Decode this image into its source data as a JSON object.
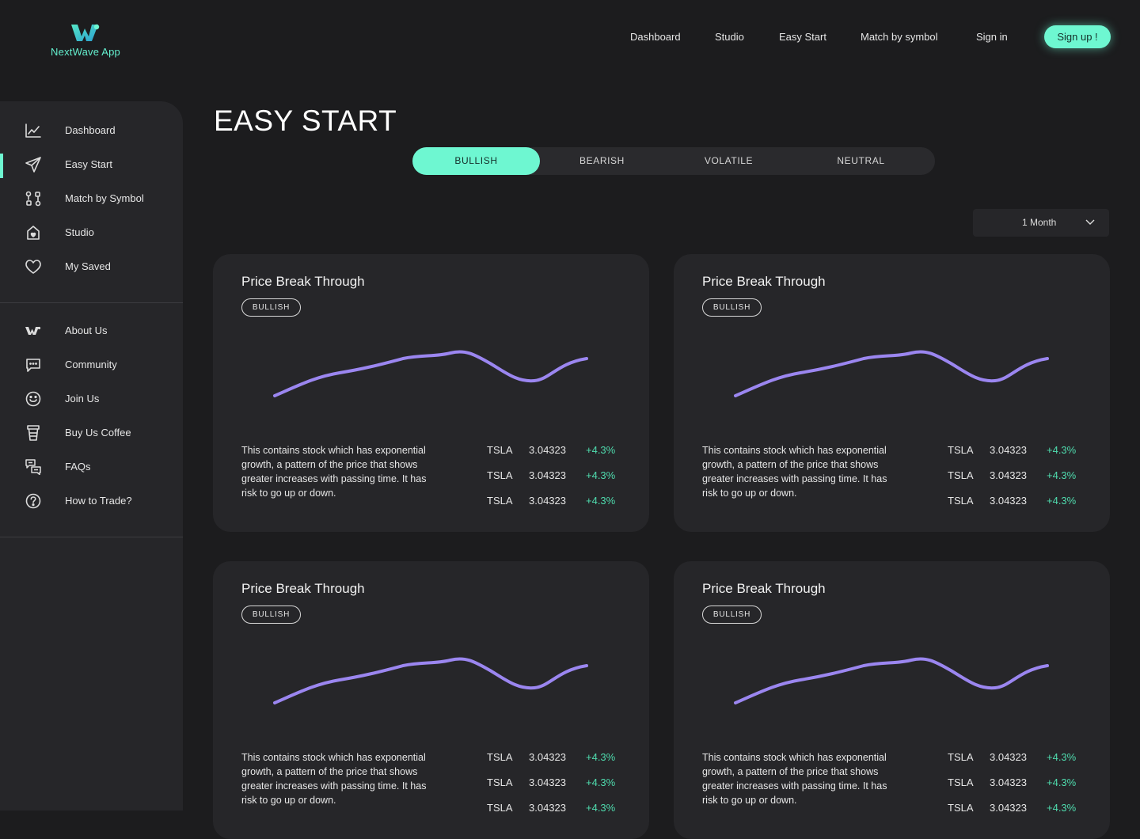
{
  "brand": {
    "name": "NextWave App"
  },
  "nav": {
    "items": [
      "Dashboard",
      "Studio",
      "Easy Start",
      "Match by symbol",
      "Sign in"
    ],
    "signup": "Sign up !"
  },
  "sidebar": {
    "items": [
      {
        "label": "Dashboard",
        "icon": "line-chart-icon"
      },
      {
        "label": "Easy Start",
        "icon": "paper-plane-icon",
        "active": true
      },
      {
        "label": "Match by Symbol",
        "icon": "match-nodes-icon"
      },
      {
        "label": "Studio",
        "icon": "house-heart-icon"
      },
      {
        "label": "My Saved",
        "icon": "heart-icon"
      }
    ],
    "secondary": [
      {
        "label": "About Us",
        "icon": "brand-logo-icon"
      },
      {
        "label": "Community",
        "icon": "chat-bubble-icon"
      },
      {
        "label": "Join Us",
        "icon": "smiley-icon"
      },
      {
        "label": "Buy Us Coffee",
        "icon": "coffee-cup-icon"
      },
      {
        "label": "FAQs",
        "icon": "faq-chat-icon"
      },
      {
        "label": "How to Trade?",
        "icon": "question-circle-icon"
      }
    ]
  },
  "page": {
    "title": "EASY START"
  },
  "tabs": {
    "items": [
      "BULLISH",
      "BEARISH",
      "VOLATILE",
      "NEUTRAL"
    ],
    "active": "BULLISH"
  },
  "period": {
    "selected": "1 Month"
  },
  "cards": [
    {
      "title": "Price Break Through",
      "badge": "BULLISH",
      "description": "This contains stock which has exponential growth, a pattern of the price that shows greater increases with passing time. It has risk to go up or down.",
      "stocks": [
        {
          "symbol": "TSLA",
          "price": "3.04323",
          "change": "+4.3%"
        },
        {
          "symbol": "TSLA",
          "price": "3.04323",
          "change": "+4.3%"
        },
        {
          "symbol": "TSLA",
          "price": "3.04323",
          "change": "+4.3%"
        }
      ]
    },
    {
      "title": "Price Break Through",
      "badge": "BULLISH",
      "description": "This contains stock which has exponential growth, a pattern of the price that shows greater increases with passing time. It has risk to go up or down.",
      "stocks": [
        {
          "symbol": "TSLA",
          "price": "3.04323",
          "change": "+4.3%"
        },
        {
          "symbol": "TSLA",
          "price": "3.04323",
          "change": "+4.3%"
        },
        {
          "symbol": "TSLA",
          "price": "3.04323",
          "change": "+4.3%"
        }
      ]
    },
    {
      "title": "Price Break Through",
      "badge": "BULLISH",
      "description": "This contains stock which has exponential growth, a pattern of the price that shows greater increases with passing time. It has risk to go up or down.",
      "stocks": [
        {
          "symbol": "TSLA",
          "price": "3.04323",
          "change": "+4.3%"
        },
        {
          "symbol": "TSLA",
          "price": "3.04323",
          "change": "+4.3%"
        },
        {
          "symbol": "TSLA",
          "price": "3.04323",
          "change": "+4.3%"
        }
      ]
    },
    {
      "title": "Price Break Through",
      "badge": "BULLISH",
      "description": "This contains stock which has exponential growth, a pattern of the price that shows greater increases with passing time. It has risk to go up or down.",
      "stocks": [
        {
          "symbol": "TSLA",
          "price": "3.04323",
          "change": "+4.3%"
        },
        {
          "symbol": "TSLA",
          "price": "3.04323",
          "change": "+4.3%"
        },
        {
          "symbol": "TSLA",
          "price": "3.04323",
          "change": "+4.3%"
        }
      ]
    }
  ],
  "colors": {
    "accent": "#6ef7d1",
    "background": "#1c1c1e",
    "panel": "#262629",
    "sparkline": "#9b86f0",
    "positive": "#4fdcae"
  }
}
